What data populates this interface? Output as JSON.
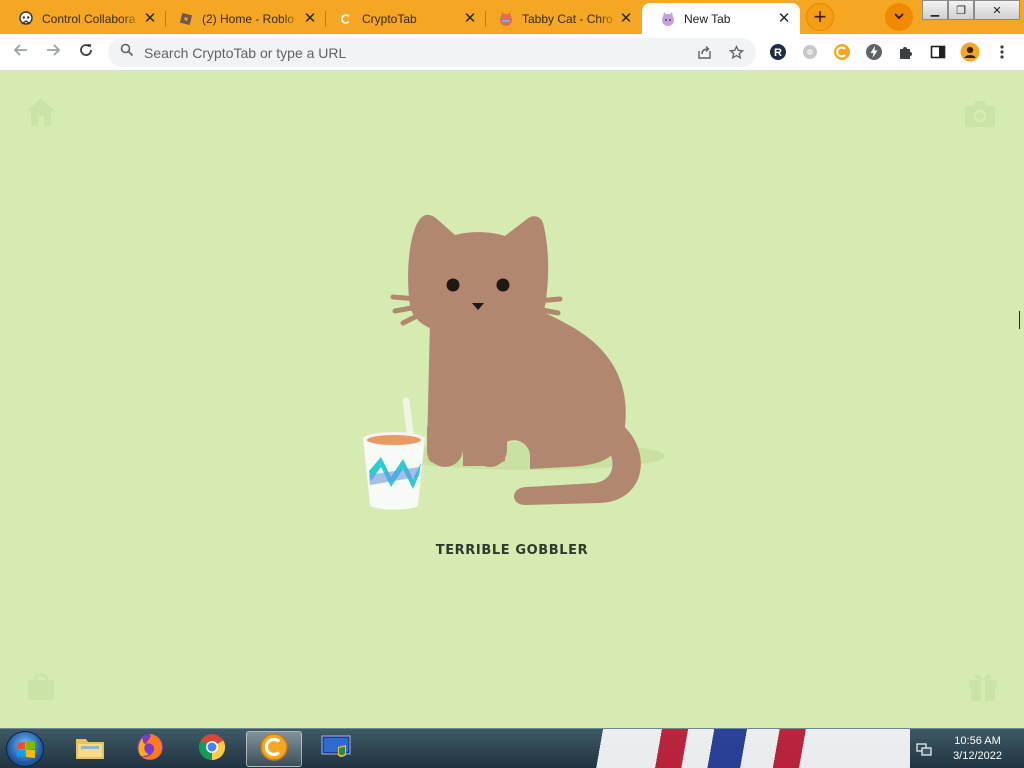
{
  "browser": {
    "tabs": [
      {
        "title": "Control Collabora",
        "favicon": "control-collaboration-icon",
        "active": false
      },
      {
        "title": "(2) Home - Roblo",
        "favicon": "roblox-icon",
        "active": false
      },
      {
        "title": "CryptoTab",
        "favicon": "cryptotab-icon",
        "active": false
      },
      {
        "title": "Tabby Cat - Chro",
        "favicon": "tabby-cat-icon",
        "active": false
      },
      {
        "title": "New Tab",
        "favicon": "tabby-cat-icon",
        "active": true
      }
    ],
    "omnibox_placeholder": "Search CryptoTab or type a URL",
    "accent_color": "#f5a623"
  },
  "page": {
    "background_color": "#d6ebb2",
    "cat_name": "TERRIBLE GOBBLER",
    "corner_icons": [
      "home-icon",
      "camera-icon",
      "shopping-bag-icon",
      "gift-icon"
    ]
  },
  "taskbar": {
    "apps": [
      "file-explorer-icon",
      "firefox-icon",
      "chrome-icon",
      "cryptotab-icon",
      "remote-desktop-icon"
    ],
    "clock_time": "10:56 AM",
    "clock_date": "3/12/2022"
  }
}
